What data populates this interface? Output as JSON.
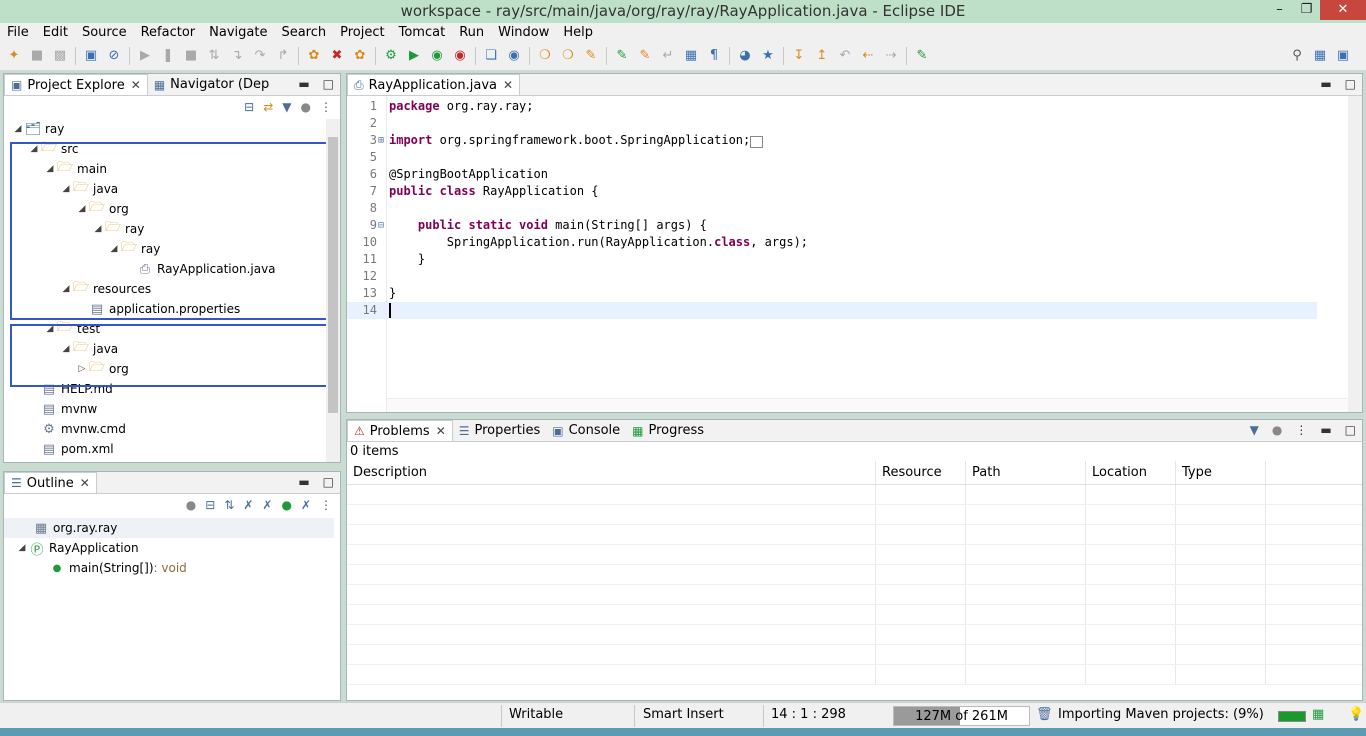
{
  "window": {
    "title": "workspace - ray/src/main/java/org/ray/ray/RayApplication.java - Eclipse IDE"
  },
  "menu": [
    "File",
    "Edit",
    "Source",
    "Refactor",
    "Navigate",
    "Search",
    "Project",
    "Tomcat",
    "Run",
    "Window",
    "Help"
  ],
  "left_tabs": {
    "project_explorer": "Project Explore",
    "navigator": "Navigator (Dep"
  },
  "tree": [
    {
      "label": "ray",
      "level": 0,
      "icon": "project-icon"
    },
    {
      "label": "src",
      "level": 1,
      "icon": "folder-icon"
    },
    {
      "label": "main",
      "level": 2,
      "icon": "folder-icon"
    },
    {
      "label": "java",
      "level": 3,
      "icon": "folder-icon"
    },
    {
      "label": "org",
      "level": 4,
      "icon": "folder-icon"
    },
    {
      "label": "ray",
      "level": 5,
      "icon": "folder-icon"
    },
    {
      "label": "ray",
      "level": 6,
      "icon": "folder-icon"
    },
    {
      "label": "RayApplication.java",
      "level": 7,
      "icon": "java-file-icon"
    },
    {
      "label": "resources",
      "level": 3,
      "icon": "folder-icon"
    },
    {
      "label": "application.properties",
      "level": 4,
      "icon": "properties-file-icon"
    },
    {
      "label": "test",
      "level": 2,
      "icon": "folder-icon"
    },
    {
      "label": "java",
      "level": 3,
      "icon": "folder-icon"
    },
    {
      "label": "org",
      "level": 4,
      "icon": "folder-icon"
    },
    {
      "label": "HELP.md",
      "level": 2,
      "icon": "md-file-icon"
    },
    {
      "label": "mvnw",
      "level": 2,
      "icon": "file-icon"
    },
    {
      "label": "mvnw.cmd",
      "level": 2,
      "icon": "cmd-file-icon"
    },
    {
      "label": "pom.xml",
      "level": 2,
      "icon": "xml-file-icon"
    }
  ],
  "outline": {
    "tab": "Outline",
    "items": [
      {
        "label": "org.ray.ray",
        "level": 0,
        "icon": "package-icon"
      },
      {
        "label": "RayApplication",
        "level": 0,
        "icon": "class-icon"
      },
      {
        "label": "main(String[])",
        "type": " : void",
        "level": 1,
        "icon": "method-icon"
      }
    ]
  },
  "editor": {
    "tab": "RayApplication.java",
    "lines": [
      {
        "n": "1",
        "text": "package org.ray.ray;"
      },
      {
        "n": "2",
        "text": ""
      },
      {
        "n": "3",
        "text": "import org.springframework.boot.SpringApplication;"
      },
      {
        "n": "5",
        "text": ""
      },
      {
        "n": "6",
        "text": "@SpringBootApplication"
      },
      {
        "n": "7",
        "text": "public class RayApplication {"
      },
      {
        "n": "8",
        "text": ""
      },
      {
        "n": "9",
        "text": "    public static void main(String[] args) {"
      },
      {
        "n": "10",
        "text": "        SpringApplication.run(RayApplication.class, args);"
      },
      {
        "n": "11",
        "text": "    }"
      },
      {
        "n": "12",
        "text": ""
      },
      {
        "n": "13",
        "text": "}"
      },
      {
        "n": "14",
        "text": ""
      }
    ]
  },
  "bottom_tabs": {
    "problems": "Problems",
    "properties": "Properties",
    "console": "Console",
    "progress": "Progress"
  },
  "problems": {
    "count": "0 items",
    "columns": [
      "Description",
      "Resource",
      "Path",
      "Location",
      "Type"
    ]
  },
  "status": {
    "writable": "Writable",
    "insert": "Smart Insert",
    "position": "14 : 1 : 298",
    "heap_used": "127M",
    "heap_total": "of 261M",
    "heap_fraction": 0.49,
    "task": "Importing Maven projects: (9%)",
    "task_progress": 0.09
  },
  "colors": {
    "highlight_box": "#3656c8",
    "keyword": "#7f0055",
    "annotation": "#646464"
  }
}
